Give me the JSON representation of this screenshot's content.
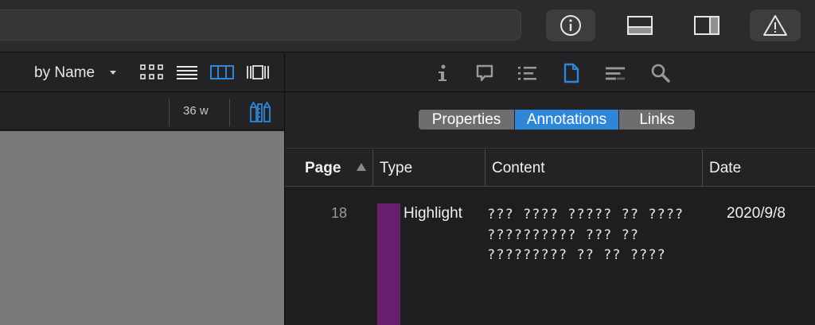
{
  "window": {
    "toolbar_icons": [
      "info-icon",
      "page-strip-icon",
      "sidebar-layout-icon",
      "warning-icon"
    ]
  },
  "left_panel": {
    "sort_label": "by Name",
    "view_modes": [
      "grid-view-icon",
      "list-view-icon",
      "columns-view-icon",
      "cover-flow-icon"
    ],
    "active_view": "columns-view-icon",
    "width_label": "36 w",
    "tools_icon": "pencil-ruler-icon"
  },
  "inspector": {
    "tab_icons": [
      "info-icon",
      "comment-icon",
      "list-icon",
      "document-icon",
      "lines-icon",
      "search-icon"
    ],
    "active_tab_icon": "document-icon",
    "segments": [
      {
        "label": "Properties",
        "active": false
      },
      {
        "label": "Annotations",
        "active": true
      },
      {
        "label": "Links",
        "active": false
      }
    ],
    "columns": {
      "page": "Page",
      "type": "Type",
      "content": "Content",
      "date": "Date"
    },
    "rows": [
      {
        "page": "18",
        "type": "Highlight",
        "color": "#6a1f6e",
        "content": "??? ???? ????? ?? ???? ?????????? ??? ?? ????????? ?? ?? ????",
        "date": "2020/9/8"
      }
    ]
  },
  "colors": {
    "accent": "#2f86d6",
    "highlight_swatch": "#6a1f6e"
  }
}
